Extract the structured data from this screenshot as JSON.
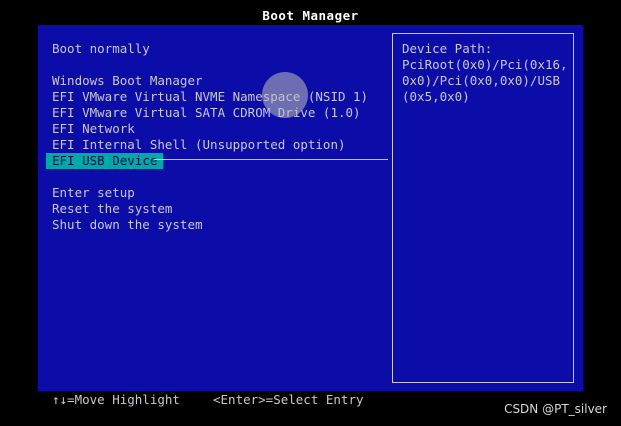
{
  "header": {
    "title": "Boot Manager"
  },
  "menu": {
    "boot_normally": "Boot normally",
    "boot_entries": [
      {
        "label": "Windows Boot Manager"
      },
      {
        "label": "EFI VMware Virtual NVME Namespace (NSID 1)"
      },
      {
        "label": "EFI VMware Virtual SATA CDROM Drive (1.0)"
      },
      {
        "label": "EFI Network"
      },
      {
        "label": "EFI Internal Shell (Unsupported option)"
      },
      {
        "label": "EFI USB Device",
        "selected": true
      }
    ],
    "actions": [
      {
        "label": "Enter setup"
      },
      {
        "label": "Reset the system"
      },
      {
        "label": "Shut down the system"
      }
    ]
  },
  "info_panel": {
    "label": "Device Path:",
    "value": "PciRoot(0x0)/Pci(0x16,0x0)/Pci(0x0,0x0)/USB(0x5,0x0)"
  },
  "footer": {
    "move_hint": "↑↓=Move Highlight",
    "select_hint": "<Enter>=Select Entry"
  },
  "watermark": "CSDN @PT_silver",
  "colors": {
    "background": "#0c0ca8",
    "text": "#c8c8d0",
    "highlight": "#00a8a8",
    "title": "#ffffff"
  }
}
